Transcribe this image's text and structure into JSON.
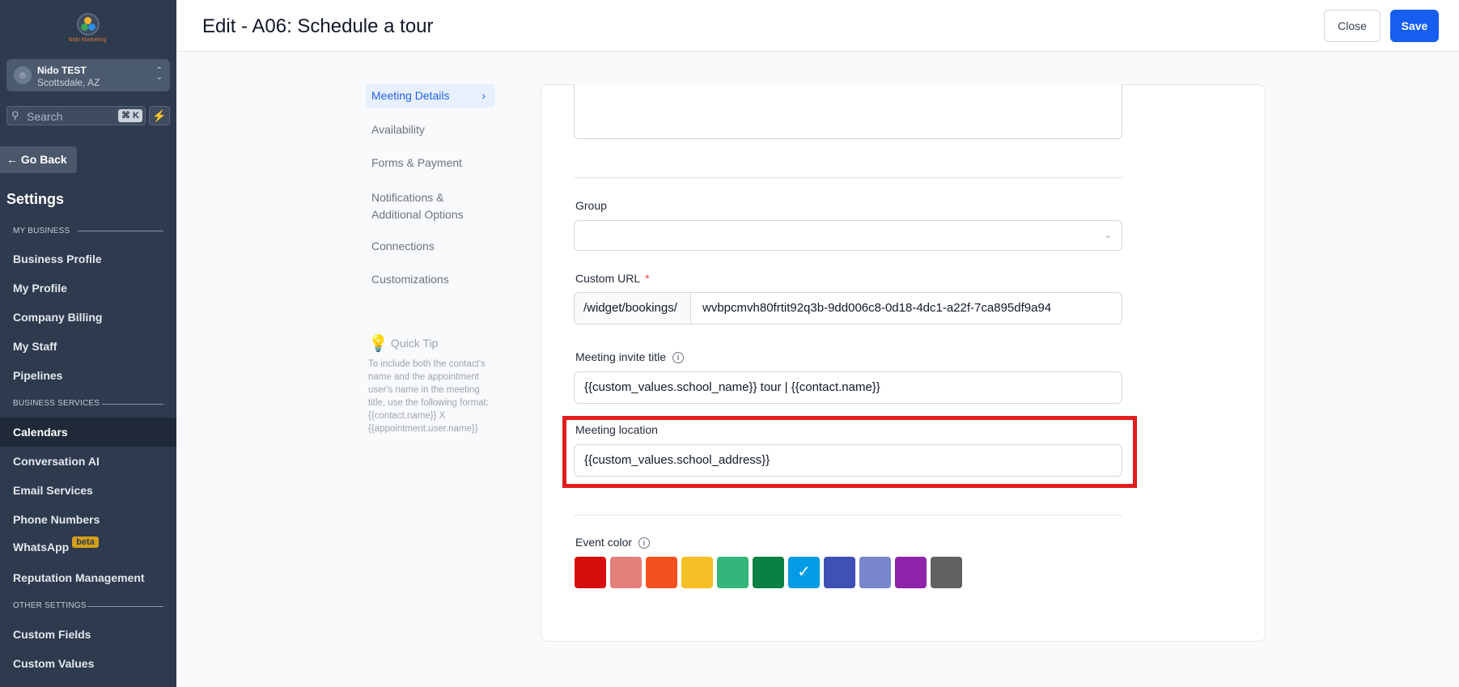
{
  "sidebar": {
    "logo_text": "Nido Marketing",
    "account": {
      "name": "Nido TEST",
      "location": "Scottsdale, AZ"
    },
    "search": {
      "placeholder": "Search",
      "shortcut": "⌘ K"
    },
    "go_back": "Go Back",
    "settings_title": "Settings",
    "sections": [
      {
        "title": "MY BUSINESS",
        "items": [
          "Business Profile",
          "My Profile",
          "Company Billing",
          "My Staff",
          "Pipelines"
        ]
      },
      {
        "title": "BUSINESS SERVICES",
        "items": [
          "Calendars",
          "Conversation AI",
          "Email Services",
          "Phone Numbers",
          "WhatsApp",
          "Reputation Management"
        ]
      },
      {
        "title": "OTHER SETTINGS",
        "items": [
          "Custom Fields",
          "Custom Values"
        ]
      }
    ],
    "active_item": "Calendars",
    "whatsapp_badge": "beta"
  },
  "header": {
    "title": "Edit - A06: Schedule a tour",
    "close_label": "Close",
    "save_label": "Save"
  },
  "tabs": [
    "Meeting Details",
    "Availability",
    "Forms & Payment",
    "Notifications & Additional Options",
    "Connections",
    "Customizations"
  ],
  "active_tab": "Meeting Details",
  "quick_tip": {
    "title": "Quick Tip",
    "body": "To include both the contact's name and the appointment user's name in the meeting title, use the following format: {{contact.name}} X {{appointment.user.name}}"
  },
  "form": {
    "group": {
      "label": "Group",
      "value": ""
    },
    "custom_url": {
      "label": "Custom URL",
      "required_mark": "*",
      "prefix": "/widget/bookings/",
      "value": "wvbpcmvh80frtit92q3b-9dd006c8-0d18-4dc1-a22f-7ca895df9a94"
    },
    "meeting_invite_title": {
      "label": "Meeting invite title",
      "value": "{{custom_values.school_name}} tour | {{contact.name}}"
    },
    "meeting_location": {
      "label": "Meeting location",
      "value": "{{custom_values.school_address}}"
    },
    "event_color": {
      "label": "Event color",
      "colors": [
        "#d70e0e",
        "#e57f7a",
        "#f4511e",
        "#f6bf26",
        "#33b679",
        "#0b8043",
        "#039be5",
        "#3f51b5",
        "#7986cb",
        "#8e24aa",
        "#616161"
      ],
      "selected_index": 6
    }
  }
}
